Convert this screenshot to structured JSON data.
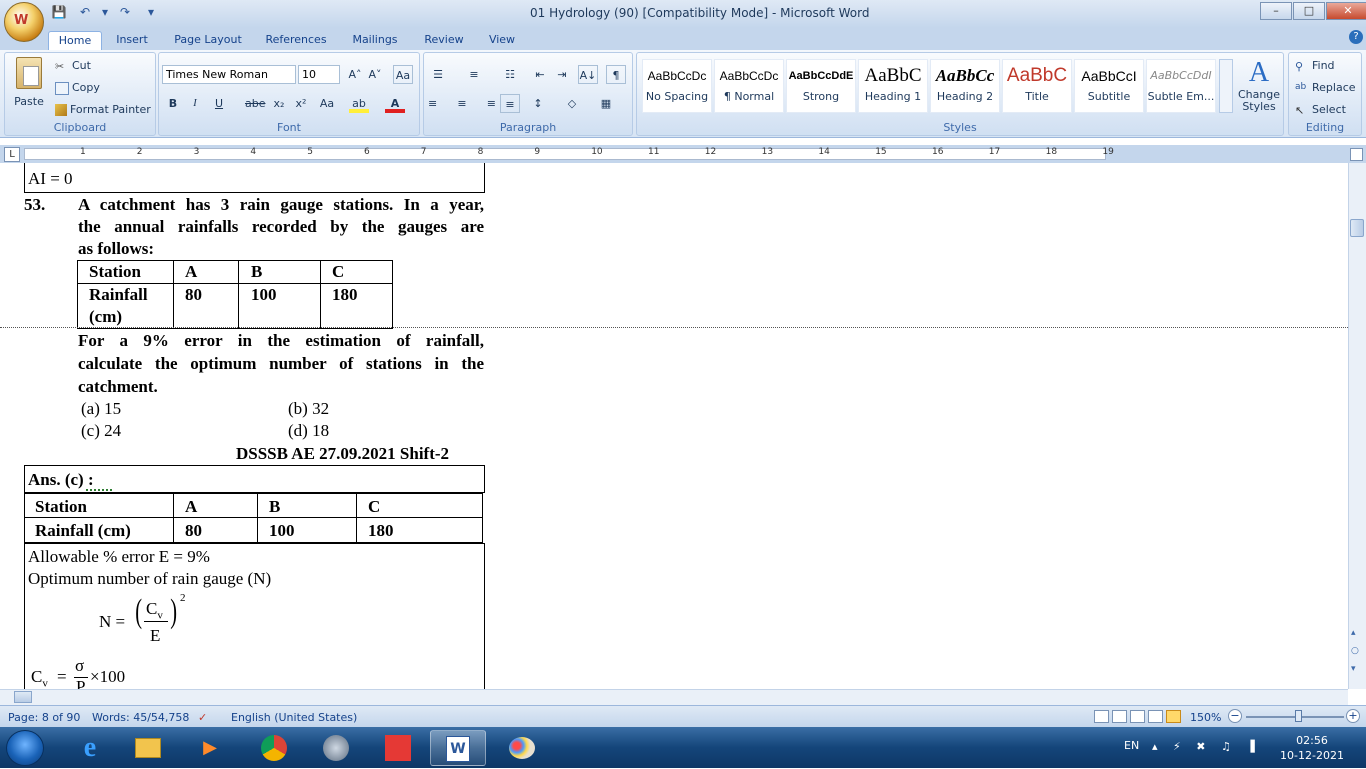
{
  "window": {
    "title": "01 Hydrology (90) [Compatibility Mode] - Microsoft Word",
    "minimize": "–",
    "maximize": "□",
    "close": "✕"
  },
  "qat": {
    "save_icon": "💾",
    "undo_icon": "↶",
    "undo_arrow": "▾",
    "redo_icon": "↷",
    "customize_icon": "▾"
  },
  "office_button_glyph": "W",
  "tabs": [
    "Home",
    "Insert",
    "Page Layout",
    "References",
    "Mailings",
    "Review",
    "View"
  ],
  "help_glyph": "?",
  "ribbon": {
    "clipboard": {
      "label": "Clipboard",
      "paste": "Paste",
      "cut": "Cut",
      "copy": "Copy",
      "format_painter": "Format Painter"
    },
    "font": {
      "label": "Font",
      "font_name": "Times New Roman",
      "font_size": "10",
      "grow": "A˄",
      "shrink": "A˅",
      "clear": "Aa",
      "bold": "B",
      "italic": "I",
      "underline": "U",
      "strike": "abe",
      "subscript": "x₂",
      "superscript": "x²",
      "change_case": "Aa",
      "highlight": "ab",
      "font_color": "A"
    },
    "paragraph": {
      "label": "Paragraph",
      "bullets": "☰",
      "numbering": "≡",
      "multilevel": "☷",
      "decrease_indent": "⇤",
      "increase_indent": "⇥",
      "sort": "A↓",
      "pilcrow": "¶",
      "align_left": "≡",
      "center": "≡",
      "align_right": "≡",
      "justify": "≡",
      "line_spacing": "↕",
      "shading": "◇",
      "borders": "▦"
    },
    "styles": {
      "label": "Styles",
      "items": [
        {
          "sample": "AaBbCcDc",
          "name": "No Spacing"
        },
        {
          "sample": "AaBbCcDc",
          "name": "¶ Normal"
        },
        {
          "sample": "AaBbCcDdE",
          "name": "Strong"
        },
        {
          "sample": "AaBbC",
          "name": "Heading 1"
        },
        {
          "sample": "AaBbCc",
          "name": "Heading 2"
        },
        {
          "sample": "AaBbC",
          "name": "Title"
        },
        {
          "sample": "AaBbCcI",
          "name": "Subtitle"
        },
        {
          "sample": "AaBbCcDdI",
          "name": "Subtle Em..."
        }
      ],
      "change_styles": "Change Styles"
    },
    "editing": {
      "label": "Editing",
      "find": "Find",
      "replace": "Replace",
      "select": "Select"
    }
  },
  "ruler": {
    "corner": "L",
    "numbers": [
      "1",
      "2",
      "3",
      "4",
      "5",
      "6",
      "7",
      "8",
      "9",
      "10",
      "11",
      "12",
      "13",
      "14",
      "15",
      "16",
      "17",
      "18",
      "19"
    ]
  },
  "document": {
    "ai_line": "AI = 0",
    "q_number": "53.",
    "q_text": [
      "A catchment has 3 rain gauge stations. In a year,",
      "the annual rainfalls recorded by the gauges are",
      "as follows:"
    ],
    "q_table": {
      "headers": [
        "Station",
        "A",
        "B",
        "C"
      ],
      "row_label": [
        "Rainfall",
        "(cm)"
      ],
      "values": [
        "80",
        "100",
        "180"
      ]
    },
    "q_text2": [
      "For a 9% error in the estimation of rainfall,",
      "calculate the optimum number of stations in the",
      "catchment."
    ],
    "options": [
      "(a)  15",
      "(b)  32",
      "(c)  24",
      "(d)  18"
    ],
    "source": "DSSSB AE 27.09.2021 Shift-2",
    "answer": "Ans. (c) :",
    "ans_table": {
      "headers": [
        "Station",
        "A",
        "B",
        "C"
      ],
      "row": [
        "Rainfall (cm)",
        "80",
        "100",
        "180"
      ]
    },
    "solution": {
      "line1": "Allowable % error E = 9%",
      "line2": "Optimum number of rain gauge (N)",
      "n_eq": "N =",
      "cv": "C",
      "cv_sub": "v",
      "e": "E",
      "exp": "2",
      "cv_line_label": "C",
      "cv_line_sub": "v",
      "eq": "=",
      "sigma": "σ",
      "x100": "×100",
      "frac_den": "P"
    }
  },
  "status": {
    "page": "Page: 8 of 90",
    "words": "Words: 45/54,758",
    "language": "English (United States)",
    "zoom": "150%"
  },
  "taskbar": {
    "language": "EN",
    "tray": "▴ ⚡ ✖ ♫ ▐",
    "time": "02:56",
    "date": "10-12-2021"
  }
}
